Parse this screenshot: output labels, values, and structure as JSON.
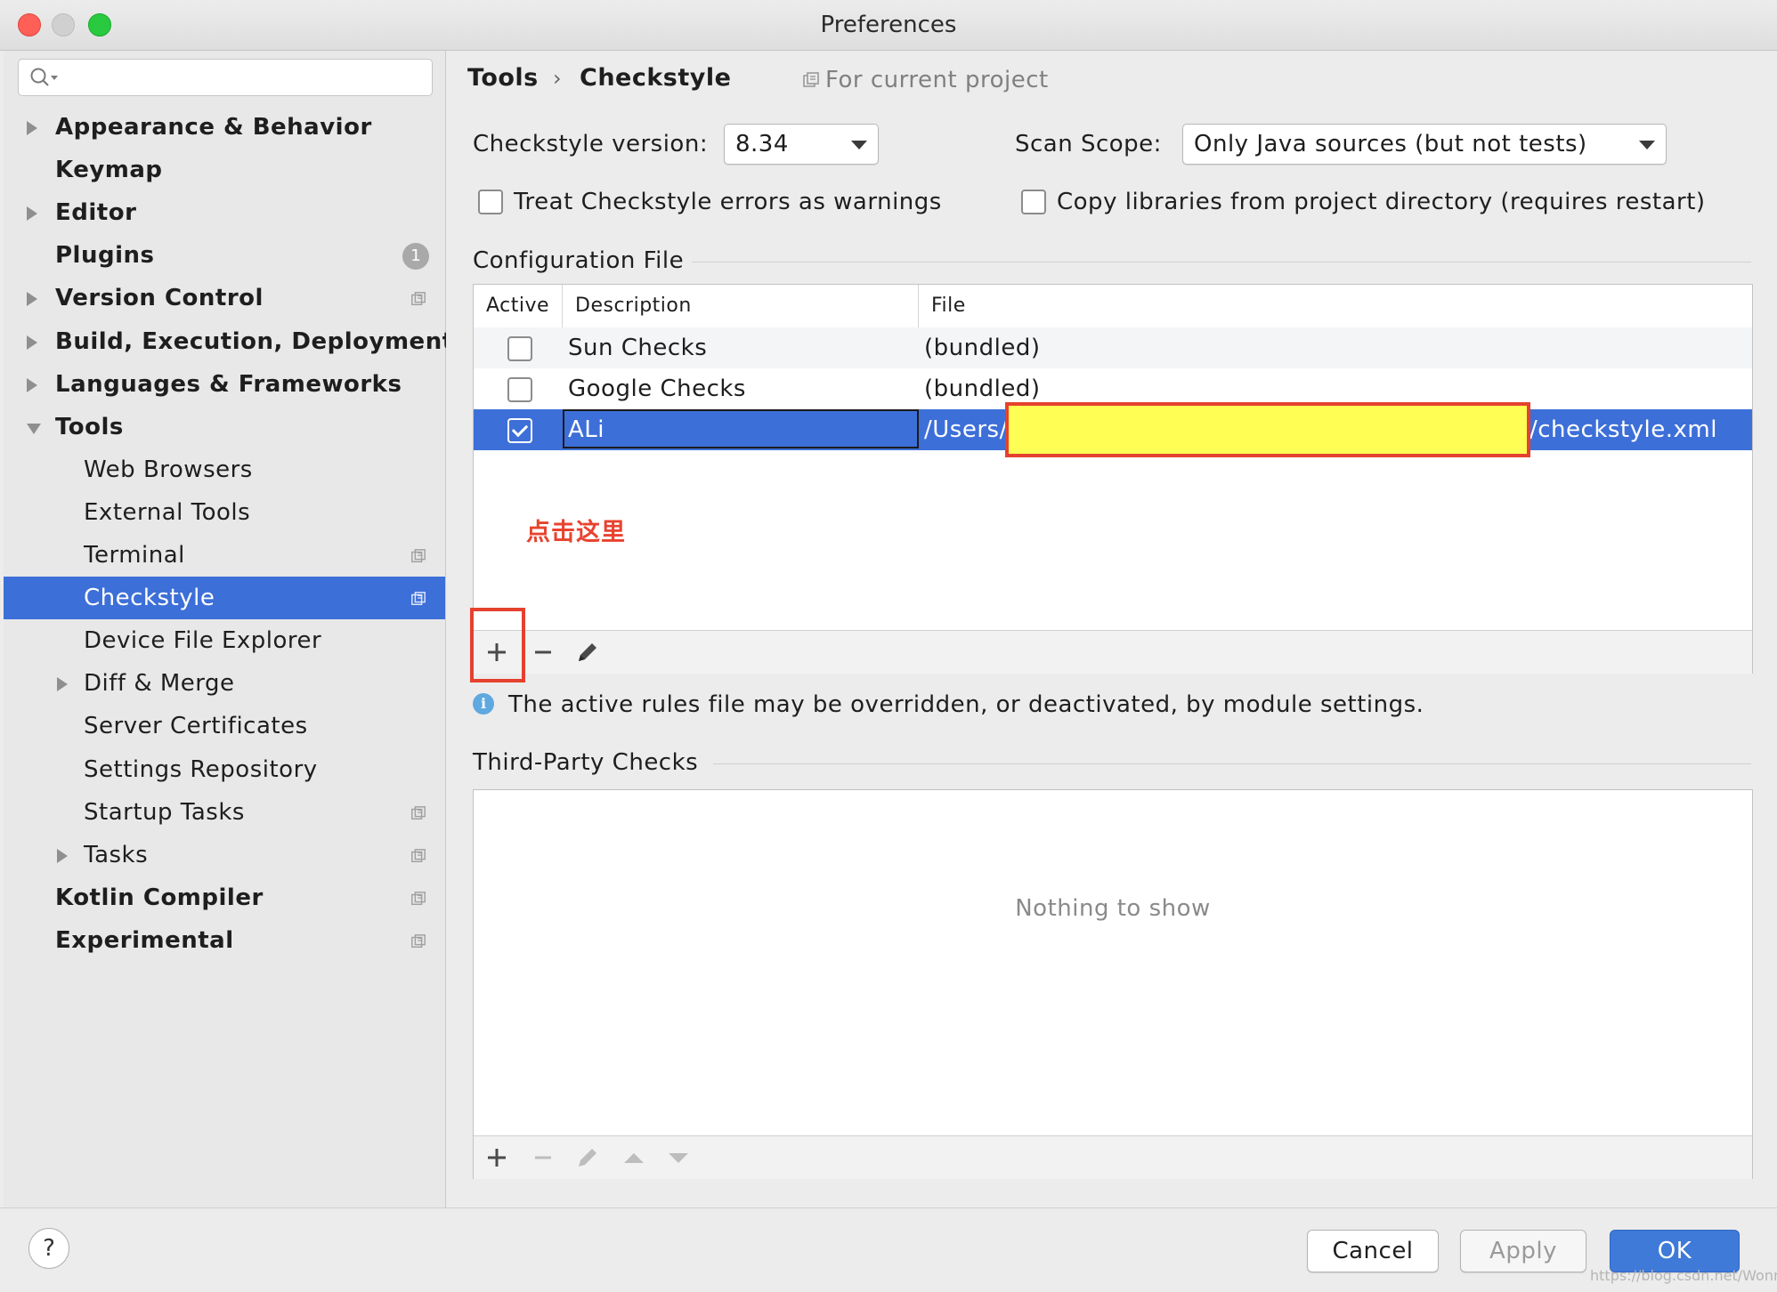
{
  "window": {
    "title": "Preferences"
  },
  "sidebar": {
    "search_placeholder": "",
    "items": [
      {
        "label": "Appearance & Behavior",
        "level": 1,
        "expandable": true,
        "expanded": false
      },
      {
        "label": "Keymap",
        "level": 1
      },
      {
        "label": "Editor",
        "level": 1,
        "expandable": true,
        "expanded": false
      },
      {
        "label": "Plugins",
        "level": 1,
        "badge": "1"
      },
      {
        "label": "Version Control",
        "level": 1,
        "expandable": true,
        "project_icon": true
      },
      {
        "label": "Build, Execution, Deployment",
        "level": 1,
        "expandable": true
      },
      {
        "label": "Languages & Frameworks",
        "level": 1,
        "expandable": true
      },
      {
        "label": "Tools",
        "level": 1,
        "expandable": true,
        "expanded": true
      },
      {
        "label": "Web Browsers",
        "level": 2
      },
      {
        "label": "External Tools",
        "level": 2
      },
      {
        "label": "Terminal",
        "level": 2,
        "project_icon": true
      },
      {
        "label": "Checkstyle",
        "level": 2,
        "selected": true,
        "project_icon": true
      },
      {
        "label": "Device File Explorer",
        "level": 2
      },
      {
        "label": "Diff & Merge",
        "level": 2,
        "expandable": true
      },
      {
        "label": "Server Certificates",
        "level": 2
      },
      {
        "label": "Settings Repository",
        "level": 2
      },
      {
        "label": "Startup Tasks",
        "level": 2,
        "project_icon": true
      },
      {
        "label": "Tasks",
        "level": 2,
        "expandable": true,
        "project_icon": true
      },
      {
        "label": "Kotlin Compiler",
        "level": 1,
        "project_icon": true
      },
      {
        "label": "Experimental",
        "level": 1,
        "project_icon": true
      }
    ]
  },
  "breadcrumb": {
    "parent": "Tools",
    "separator": "›",
    "current": "Checkstyle",
    "scope_note": "For current project"
  },
  "settings": {
    "version_label": "Checkstyle version:",
    "version_value": "8.34",
    "scan_scope_label": "Scan Scope:",
    "scan_scope_value": "Only Java sources (but not tests)",
    "treat_errors_label": "Treat Checkstyle errors as warnings",
    "treat_errors_checked": false,
    "copy_libs_label": "Copy libraries from project directory (requires restart)",
    "copy_libs_checked": false
  },
  "config_file": {
    "section_title": "Configuration File",
    "columns": [
      "Active",
      "Description",
      "File"
    ],
    "rows": [
      {
        "active": false,
        "description": "Sun Checks",
        "file": "(bundled)"
      },
      {
        "active": false,
        "description": "Google Checks",
        "file": "(bundled)"
      },
      {
        "active": true,
        "description": "ALi",
        "file_prefix": "/Users/",
        "file_suffix": "/checkstyle.xml",
        "selected": true
      }
    ],
    "annotation": "点击这里",
    "info_text": "The active rules file may be overridden, or deactivated, by module settings."
  },
  "third_party": {
    "section_title": "Third-Party Checks",
    "empty_text": "Nothing to show"
  },
  "footer": {
    "help": "?",
    "cancel": "Cancel",
    "apply": "Apply",
    "ok": "OK"
  },
  "watermark": "https://blog.csdn.net/WonnyLu",
  "colors": {
    "selection": "#3d6fd8",
    "annotation_red": "#e5412e",
    "redaction_yellow": "#fffe54"
  }
}
